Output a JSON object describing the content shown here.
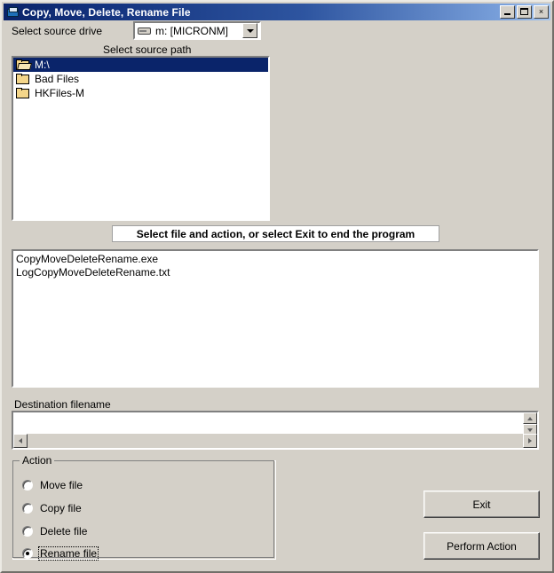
{
  "window": {
    "title": "Copy, Move, Delete, Rename File",
    "icon": "app-icon",
    "controls": {
      "minimize": "minimize-icon",
      "maximize": "maximize-icon",
      "close": "×"
    }
  },
  "source_drive": {
    "label": "Select source drive",
    "icon": "drive-icon",
    "selected": "m: [MICRONM]",
    "options": [
      "m: [MICRONM]"
    ]
  },
  "source_path": {
    "label": "Select source path",
    "nodes": [
      {
        "name": "M:\\",
        "icon": "folder-open-icon",
        "selected": true
      },
      {
        "name": "Bad Files",
        "icon": "folder-icon",
        "selected": false
      },
      {
        "name": "HKFiles-M",
        "icon": "folder-icon",
        "selected": false
      }
    ]
  },
  "status": {
    "message": "Select file and action, or select Exit to end the program"
  },
  "file_list": {
    "files": [
      "CopyMoveDeleteRename.exe",
      "LogCopyMoveDeleteRename.txt"
    ]
  },
  "destination": {
    "label": "Destination filename",
    "value": "",
    "placeholder": ""
  },
  "action_group": {
    "title": "Action",
    "options": [
      {
        "label": "Move file",
        "selected": false,
        "focused": false
      },
      {
        "label": "Copy file",
        "selected": false,
        "focused": false
      },
      {
        "label": "Delete file",
        "selected": false,
        "focused": false
      },
      {
        "label": "Rename file",
        "selected": true,
        "focused": true
      }
    ]
  },
  "buttons": {
    "exit": "Exit",
    "perform": "Perform Action"
  },
  "colors": {
    "face": "#d4d0c8",
    "title_start": "#0a246a",
    "title_end": "#a6c6ef",
    "selection": "#0a246a",
    "folder": "#f4d68a"
  }
}
